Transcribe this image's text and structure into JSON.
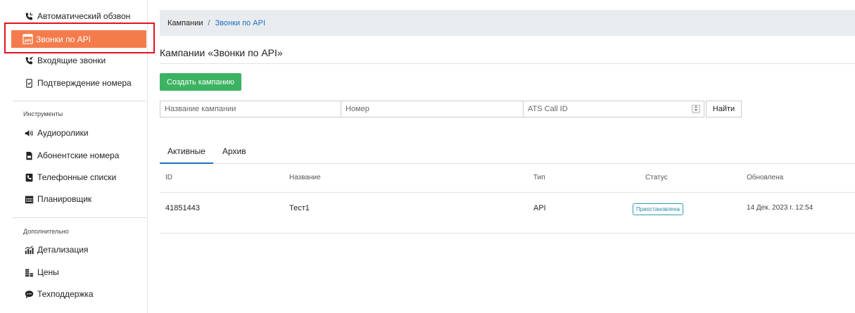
{
  "sidebar": {
    "items": [
      {
        "label": "Автоматический обзвон",
        "icon": "phone-icon"
      },
      {
        "label": "Звонки по API",
        "icon": "api-icon",
        "active": true
      },
      {
        "label": "Входящие звонки",
        "icon": "incoming-phone-icon"
      },
      {
        "label": "Подтверждение номера",
        "icon": "phone-check-icon"
      }
    ],
    "section_tools": "Инструменты",
    "tools": [
      {
        "label": "Аудиоролики",
        "icon": "speaker-icon"
      },
      {
        "label": "Абонентские номера",
        "icon": "sim-card-icon"
      },
      {
        "label": "Телефонные списки",
        "icon": "phone-book-icon"
      },
      {
        "label": "Планировщик",
        "icon": "calendar-icon"
      }
    ],
    "section_extra": "Дополнительно",
    "extra": [
      {
        "label": "Детализация",
        "icon": "chart-icon"
      },
      {
        "label": "Цены",
        "icon": "coins-icon"
      },
      {
        "label": "Техподдержка",
        "icon": "chat-icon"
      }
    ]
  },
  "breadcrumb": {
    "root": "Кампании",
    "separator": "/",
    "current": "Звонки по API"
  },
  "page_title": "Кампании «Звонки по API»",
  "create_button": "Создать кампанию",
  "filters": {
    "name_placeholder": "Название кампании",
    "number_placeholder": "Номер",
    "ats_placeholder": "ATS Call ID",
    "find_button": "Найти"
  },
  "tabs": [
    {
      "label": "Активные",
      "active": true
    },
    {
      "label": "Архив"
    }
  ],
  "table": {
    "headers": [
      "ID",
      "Название",
      "Тип",
      "Статус",
      "Обновлена"
    ],
    "rows": [
      {
        "id": "41851443",
        "name": "Тест1",
        "type": "API",
        "status": "Приостановлена",
        "updated": "14 Дек. 2023 г. 12:54"
      }
    ]
  },
  "colors": {
    "accent": "#f47c4c",
    "primary": "#1e6ec0",
    "success": "#3cb362",
    "status": "#2a9db5",
    "highlight": "#e0141d"
  }
}
